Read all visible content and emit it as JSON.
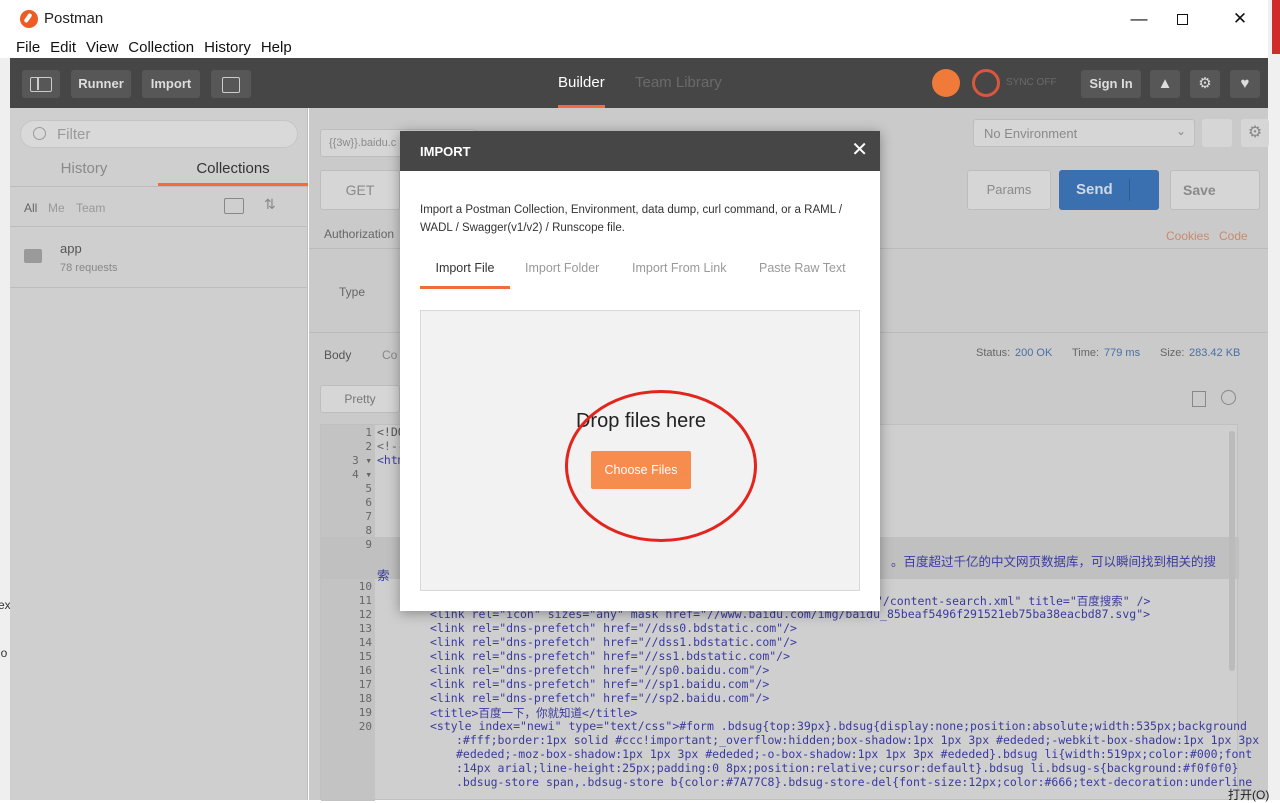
{
  "window": {
    "title": "Postman"
  },
  "menu": [
    "File",
    "Edit",
    "View",
    "Collection",
    "History",
    "Help"
  ],
  "toolbar": {
    "runner": "Runner",
    "import": "Import",
    "builder": "Builder",
    "team_library": "Team Library",
    "sync": "SYNC OFF",
    "sign_in": "Sign In"
  },
  "sidebar": {
    "filter_placeholder": "Filter",
    "tabs": {
      "history": "History",
      "collections": "Collections"
    },
    "filters": {
      "all": "All",
      "me": "Me",
      "team": "Team"
    },
    "collection": {
      "name": "app",
      "count": "78 requests"
    }
  },
  "request": {
    "url_tab": "{{3w}}.baidu.c",
    "method": "GET",
    "params": "Params",
    "send": "Send",
    "save": "Save",
    "environment": "No Environment",
    "authorization": "Authorization",
    "type_label": "Type",
    "cookies": "Cookies",
    "code": "Code"
  },
  "response": {
    "body_tab": "Body",
    "cookies_tab": "Co",
    "pretty": "Pretty",
    "status_label": "Status:",
    "status_value": "200 OK",
    "time_label": "Time:",
    "time_value": "779 ms",
    "size_label": "Size:",
    "size_value": "283.42 KB"
  },
  "code": {
    "l1": "<!DO",
    "l2": "<!--",
    "l3": "<htm",
    "l9a": "。百度超过千亿的中文网页数据库，可以瞬间找到相关的搜",
    "l9b": "索",
    "l11": "\"/content-search.xml\" title=\"百度搜索\" />",
    "l12": "<link rel=\"icon\" sizes=\"any\" mask href=\"//www.baidu.com/img/baidu_85beaf5496f291521eb75ba38eacbd87.svg\">",
    "l13": "<link rel=\"dns-prefetch\" href=\"//dss0.bdstatic.com\"/>",
    "l14": "<link rel=\"dns-prefetch\" href=\"//dss1.bdstatic.com\"/>",
    "l15": "<link rel=\"dns-prefetch\" href=\"//ss1.bdstatic.com\"/>",
    "l16": "<link rel=\"dns-prefetch\" href=\"//sp0.baidu.com\"/>",
    "l17": "<link rel=\"dns-prefetch\" href=\"//sp1.baidu.com\"/>",
    "l18": "<link rel=\"dns-prefetch\" href=\"//sp2.baidu.com\"/>",
    "l19": "<title>百度一下，你就知道</title>",
    "l20": "<style index=\"newi\" type=\"text/css\">#form .bdsug{top:39px}.bdsug{display:none;position:absolute;width:535px;background",
    "l20b": ":#fff;border:1px solid #ccc!important;_overflow:hidden;box-shadow:1px 1px 3px #ededed;-webkit-box-shadow:1px 1px 3px",
    "l20c": "#ededed;-moz-box-shadow:1px 1px 3px #ededed;-o-box-shadow:1px 1px 3px #ededed}.bdsug li{width:519px;color:#000;font",
    "l20d": ":14px arial;line-height:25px;padding:0 8px;position:relative;cursor:default}.bdsug li.bdsug-s{background:#f0f0f0}",
    "l20e": ".bdsug-store span,.bdsug-store b{color:#7A77C8}.bdsug-store-del{font-size:12px;color:#666;text-decoration:underline"
  },
  "modal": {
    "title": "IMPORT",
    "description": "Import a Postman Collection, Environment, data dump, curl command, or a RAML / WADL / Swagger(v1/v2) / Runscope file.",
    "tabs": [
      "Import File",
      "Import Folder",
      "Import From Link",
      "Paste Raw Text"
    ],
    "drop_text": "Drop files here",
    "choose_button": "Choose Files"
  },
  "desktop": {
    "left_text_1": "ex",
    "left_text_2": "lo",
    "right_text": "打开(O)"
  }
}
